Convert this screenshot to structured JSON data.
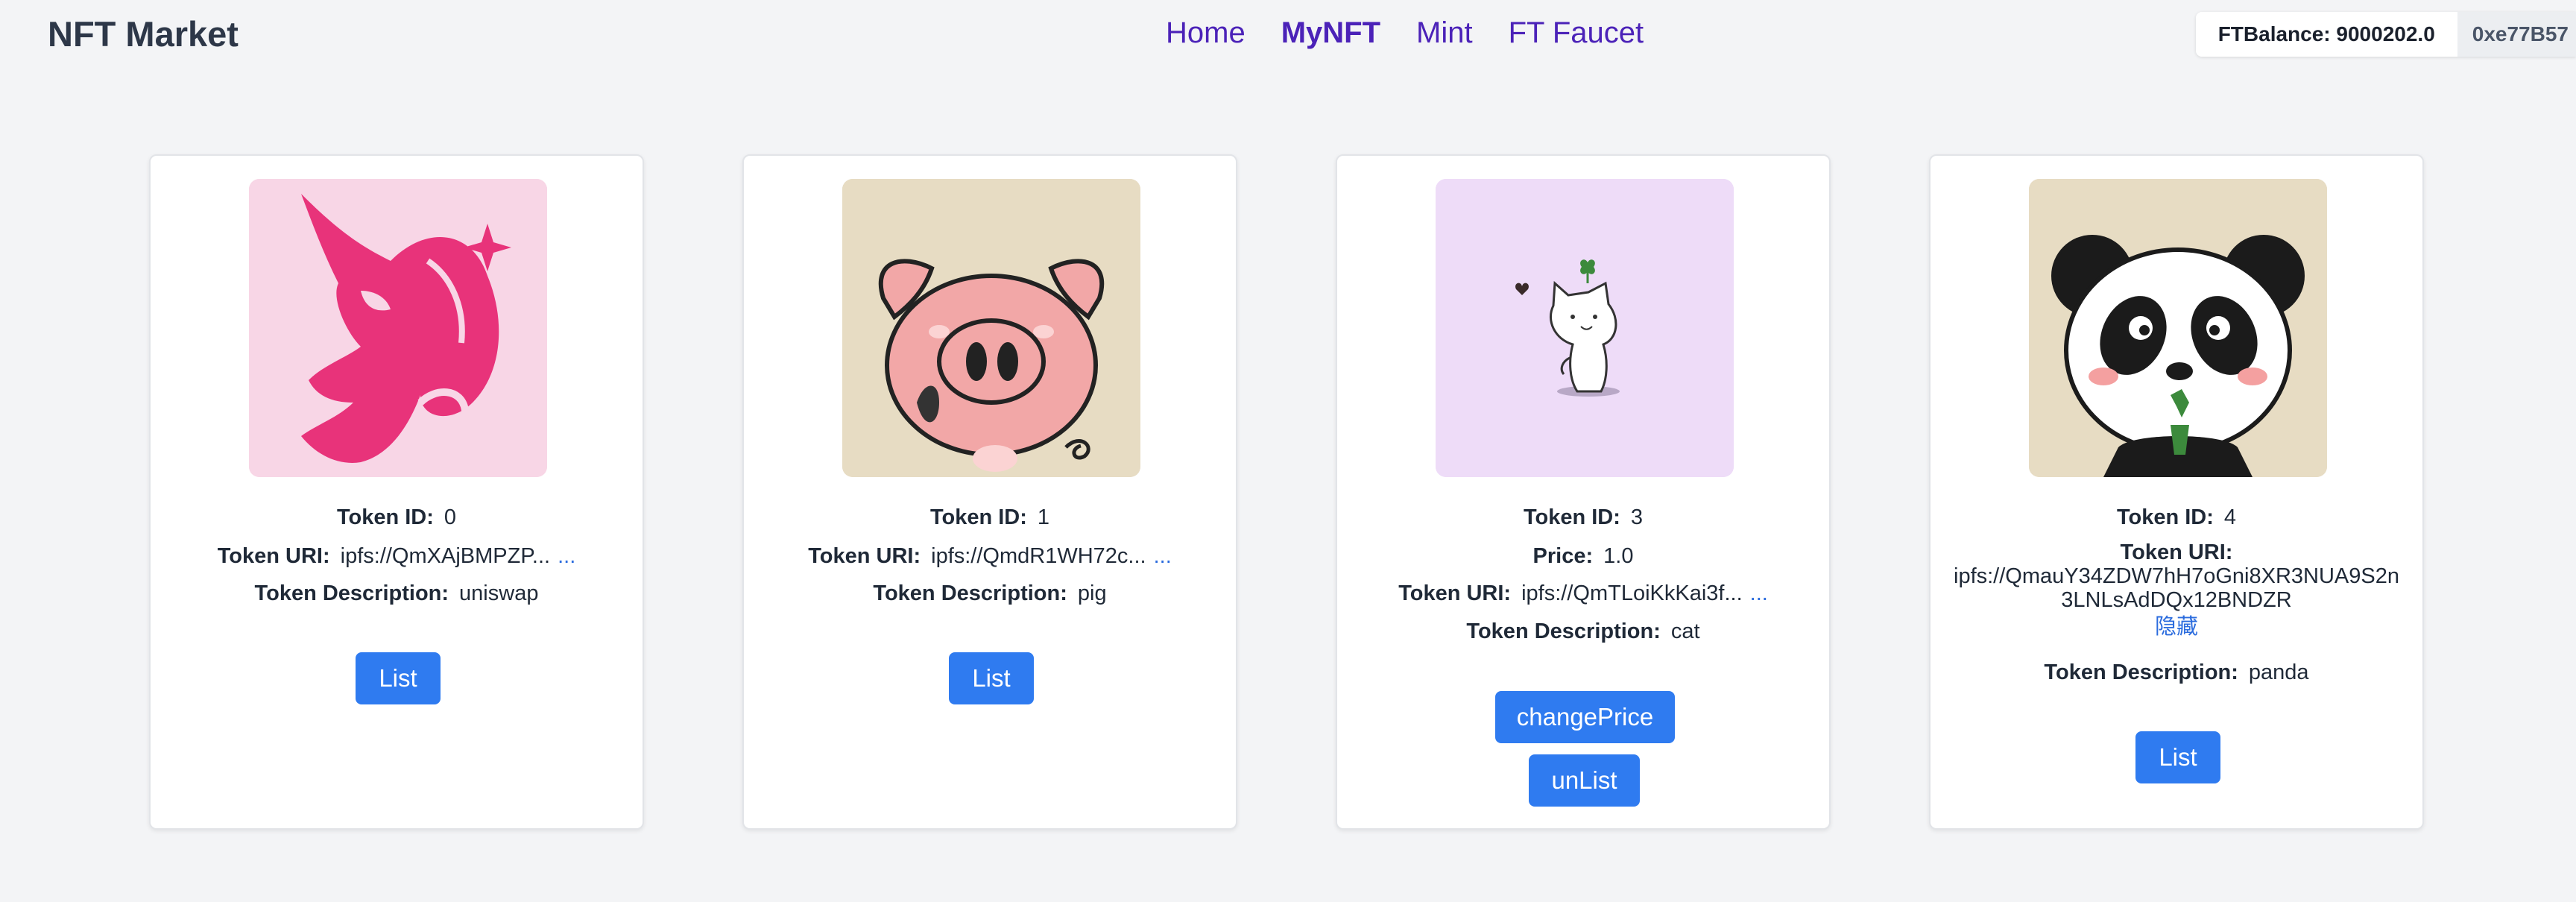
{
  "header": {
    "brand": "NFT Market",
    "nav": [
      {
        "label": "Home",
        "active": false
      },
      {
        "label": "MyNFT",
        "active": true
      },
      {
        "label": "Mint",
        "active": false
      },
      {
        "label": "FT Faucet",
        "active": false
      }
    ],
    "balance": "FTBalance: 9000202.0",
    "address": "0xe77B57"
  },
  "labels": {
    "token_id": "Token ID:",
    "token_uri": "Token URI:",
    "token_description": "Token Description:",
    "price": "Price:"
  },
  "cards": [
    {
      "token_id": "0",
      "token_uri": "ipfs://QmXAjBMPZP...",
      "uri_more": "...",
      "description": "uniswap",
      "image": "unicorn-image",
      "button": "List"
    },
    {
      "token_id": "1",
      "token_uri": "ipfs://QmdR1WH72c...",
      "uri_more": "...",
      "description": "pig",
      "image": "pig-image",
      "button": "List"
    },
    {
      "token_id": "3",
      "price": "1.0",
      "token_uri": "ipfs://QmTLoiKkKai3f...",
      "uri_more": "...",
      "description": "cat",
      "image": "cat-image",
      "buttons": [
        "changePrice",
        "unList"
      ]
    },
    {
      "token_id": "4",
      "token_uri_full": "ipfs://QmauY34ZDW7hH7oGni8XR3NUA9S2n3LNLsAdDQx12BNDZR",
      "token_uri_line1": "ipfs://QmauY34ZDW7hH7oGni8XR3NUA9S2n",
      "token_uri_line2": "3LNLsAdDQx12BNDZR",
      "hide_label": "隐藏",
      "description": "panda",
      "image": "panda-image",
      "button": "List"
    }
  ],
  "colors": {
    "nav": "#4b22b8",
    "button": "#2f7bf0",
    "link": "#2b6cde",
    "background": "#f3f4f6"
  }
}
